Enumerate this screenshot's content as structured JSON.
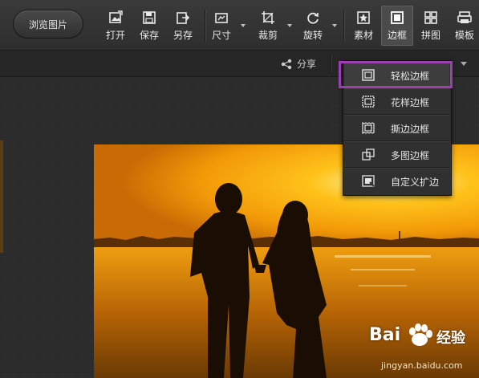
{
  "toolbar": {
    "browse_label": "浏览图片",
    "tools": [
      {
        "label": "打开",
        "icon": "open-image-icon"
      },
      {
        "label": "保存",
        "icon": "save-icon"
      },
      {
        "label": "另存",
        "icon": "save-as-icon"
      },
      {
        "label": "尺寸",
        "icon": "resize-icon"
      },
      {
        "label": "裁剪",
        "icon": "crop-icon"
      },
      {
        "label": "旋转",
        "icon": "rotate-icon"
      },
      {
        "label": "素材",
        "icon": "sticker-icon"
      },
      {
        "label": "边框",
        "icon": "frame-icon",
        "active": true
      },
      {
        "label": "拼图",
        "icon": "collage-icon"
      },
      {
        "label": "模板",
        "icon": "template-icon"
      }
    ]
  },
  "subbar": {
    "share_label": "分享"
  },
  "frame_menu": {
    "items": [
      {
        "label": "轻松边框",
        "icon": "simple-frame-icon",
        "highlighted": true
      },
      {
        "label": "花样边框",
        "icon": "pattern-frame-icon"
      },
      {
        "label": "撕边边框",
        "icon": "torn-frame-icon"
      },
      {
        "label": "多图边框",
        "icon": "multi-frame-icon"
      },
      {
        "label": "自定义扩边",
        "icon": "custom-extend-icon"
      }
    ]
  },
  "watermark": {
    "brand": "Bai",
    "brand_suffix": "经验",
    "url": "jingyan.baidu.com"
  },
  "colors": {
    "toolbar_bg": "#333333",
    "highlight_border": "#9b3fb3",
    "menu_bg": "#303030"
  }
}
